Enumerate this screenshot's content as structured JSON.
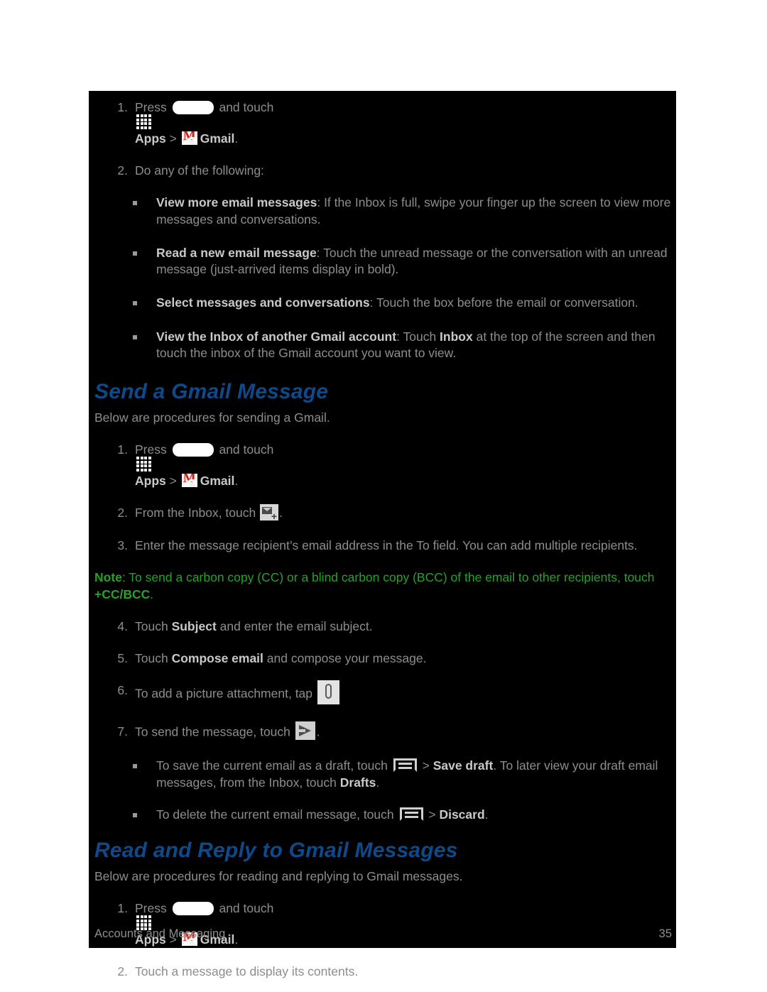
{
  "document": {
    "footer_section": "Accounts and Messaging",
    "page_number": "35"
  },
  "colors": {
    "panel_background": "#000000",
    "body_text": "#8d8d8d",
    "bold_text": "#c9c9c9",
    "heading_blue": "#0e4a8a",
    "note_green": "#2aa02a",
    "gmail_red": "#d81b12"
  },
  "top_steps": [
    {
      "num": "1.",
      "segments": [
        {
          "type": "text",
          "value": "Press "
        },
        {
          "type": "icon",
          "value": "home-key-icon"
        },
        {
          "type": "text",
          "value": " and touch "
        },
        {
          "type": "icon",
          "value": "apps-grid-icon"
        },
        {
          "type": "bold",
          "value": "Apps"
        },
        {
          "type": "text",
          "value": " > "
        },
        {
          "type": "icon",
          "value": "gmail-icon"
        },
        {
          "type": "bold",
          "value": "Gmail"
        },
        {
          "type": "text",
          "value": "."
        }
      ],
      "plain": "Press [Home] and touch [Apps icon] Apps > [Gmail icon] Gmail."
    },
    {
      "num": "2.",
      "plain": "Do any of the following:"
    }
  ],
  "top_bullets": [
    {
      "lead": "View more email messages",
      "rest": ": If the Inbox is full, swipe your finger up the screen to view more messages and conversations."
    },
    {
      "lead": "Read a new email message",
      "rest": ": Touch the unread message or the conversation with an unread message (just-arrived items display in bold)."
    },
    {
      "lead": "Select messages and conversations",
      "rest": ": Touch the box before the email or conversation."
    },
    {
      "lead": "View the Inbox of another Gmail account",
      "rest_a": ": Touch ",
      "rest_bold": "Inbox",
      "rest_b": " at the top of the screen and then touch the inbox of the Gmail account you want to view."
    }
  ],
  "send_section": {
    "title": "Send a Gmail Message",
    "intro": "Below are procedures for sending a Gmail.",
    "step1_num": "1.",
    "step1_press": "Press ",
    "step1_and_touch": " and touch ",
    "step1_apps": "Apps",
    "step1_gt": " > ",
    "step1_gmail": "Gmail",
    "step1_period": ".",
    "step2_num": "2.",
    "step2_a": "From the Inbox, touch ",
    "step2_b": ".",
    "step3_num": "3.",
    "step3": "Enter the message recipient’s email address in the To field. You can add multiple recipients.",
    "note_lead": "Note",
    "note_a": ": To send a carbon copy (CC) or a blind carbon copy (BCC) of the email to other recipients, touch ",
    "note_bold": "+CC/BCC",
    "note_b": ".",
    "step4_num": "4.",
    "step4_a": "Touch ",
    "step4_bold": "Subject",
    "step4_b": " and enter the email subject.",
    "step5_num": "5.",
    "step5_a": "Touch ",
    "step5_bold": "Compose email",
    "step5_b": " and compose your message.",
    "step6_num": "6.",
    "step6_a": "To add a picture attachment, tap ",
    "step7_num": "7.",
    "step7_a": "To send the message, touch ",
    "step7_b": ".",
    "bullet1_a": "To save the current email as a draft, touch ",
    "bullet1_gt": " > ",
    "bullet1_bold": "Save draft",
    "bullet1_b": ". To later view your draft email messages, from the Inbox, touch ",
    "bullet1_bold2": "Drafts",
    "bullet1_c": ".",
    "bullet2_a": "To delete the current email message, touch ",
    "bullet2_gt": " > ",
    "bullet2_bold": "Discard",
    "bullet2_b": "."
  },
  "read_section": {
    "title": "Read and Reply to Gmail Messages",
    "intro": "Below are procedures for reading and replying to Gmail messages.",
    "step1_num": "1.",
    "step1_press": "Press ",
    "step1_and_touch": " and touch ",
    "step1_apps": "Apps",
    "step1_gt": " > ",
    "step1_gmail": "Gmail",
    "step1_period": ".",
    "step2_num": "2.",
    "step2": "Touch a message to display its contents."
  },
  "icons": {
    "home": "home-key-icon",
    "apps": "apps-grid-icon",
    "gmail": "gmail-icon",
    "compose": "compose-email-icon",
    "attach": "paperclip-attach-icon",
    "send": "send-arrow-icon",
    "menu": "menu-key-icon"
  }
}
